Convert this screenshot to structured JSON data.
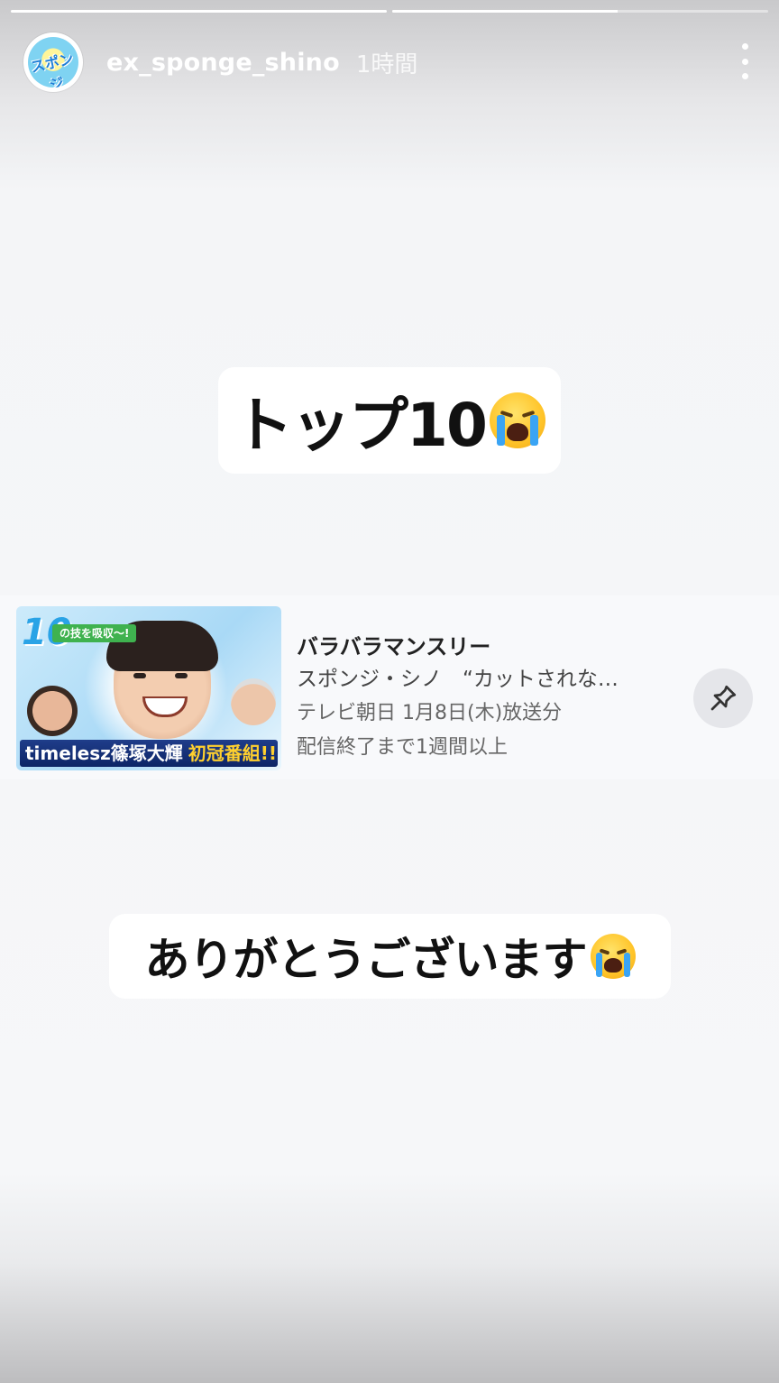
{
  "story": {
    "progress": [
      1.0,
      0.6
    ],
    "username": "ex_sponge_shino",
    "timestamp": "1時間",
    "avatar_label": "スポンジ・シノ",
    "more_icon": "more-vertical-icon"
  },
  "stickers": {
    "top_text": "トップ10",
    "bottom_text": "ありがとうございます",
    "emoji": "loudly-crying-face"
  },
  "card": {
    "thumbnail": {
      "rank_badge": "10",
      "banner_text": "の技を吸収〜!",
      "caption_main": "timelesz篠塚大輝",
      "caption_highlight": "初冠番組!!"
    },
    "title": "バラバラマンスリー",
    "subtitle": "スポンジ・シノ　“カットされな…",
    "broadcast": "テレビ朝日 1月8日(木)放送分",
    "availability": "配信終了まで1週間以上",
    "pin_icon": "pin-icon"
  }
}
